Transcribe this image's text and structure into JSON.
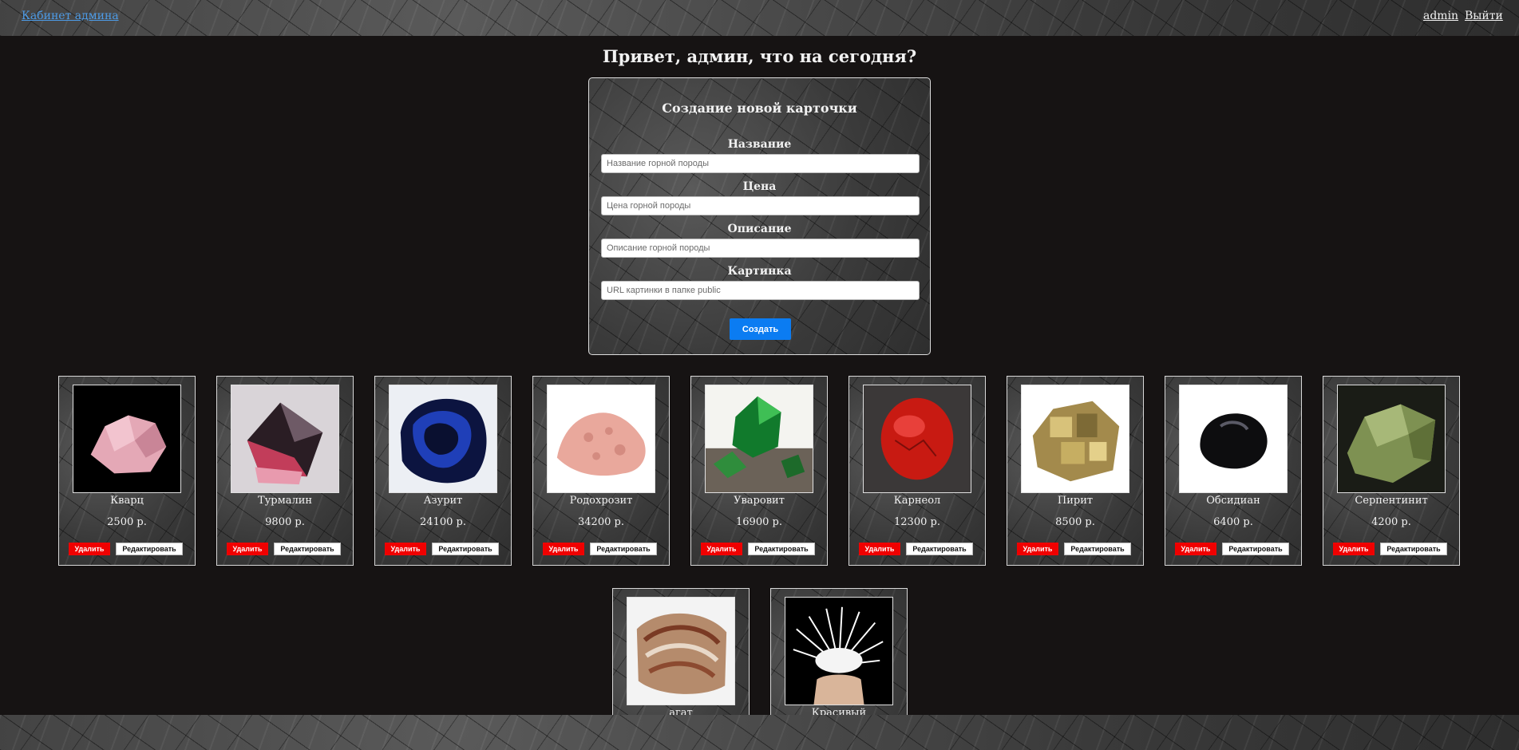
{
  "header": {
    "brand": "Кабинет админа",
    "user": "admin",
    "logout": "Выйти"
  },
  "greeting": "Привет, админ, что на сегодня?",
  "form": {
    "title": "Создание новой карточки",
    "fields": [
      {
        "label": "Название",
        "placeholder": "Название горной породы"
      },
      {
        "label": "Цена",
        "placeholder": "Цена горной породы"
      },
      {
        "label": "Описание",
        "placeholder": "Описание горной породы"
      },
      {
        "label": "Картинка",
        "placeholder": "URL картинки в папке public"
      }
    ],
    "submit": "Создать"
  },
  "card_actions": {
    "delete": "Удалить",
    "edit": "Редактировать"
  },
  "cards": [
    {
      "name": "Кварц",
      "price": "2500 р.",
      "image": "rose-quartz"
    },
    {
      "name": "Турмалин",
      "price": "9800 р.",
      "image": "tourmaline"
    },
    {
      "name": "Азурит",
      "price": "24100 р.",
      "image": "azurite"
    },
    {
      "name": "Родохрозит",
      "price": "34200 р.",
      "image": "rhodochrosite"
    },
    {
      "name": "Уваровит",
      "price": "16900 р.",
      "image": "uvarovite"
    },
    {
      "name": "Карнеол",
      "price": "12300 р.",
      "image": "carnelian"
    },
    {
      "name": "Пирит",
      "price": "8500 р.",
      "image": "pyrite"
    },
    {
      "name": "Обсидиан",
      "price": "6400 р.",
      "image": "obsidian"
    },
    {
      "name": "Серпентинит",
      "price": "4200 р.",
      "image": "serpentinite"
    },
    {
      "name": "агат",
      "price": "",
      "image": "agate"
    },
    {
      "name": "Красивый",
      "price": "",
      "image": "white-mineral"
    }
  ],
  "colors": {
    "background": "#161313",
    "link": "#4d9be6",
    "primary_button": "#0b7cf2",
    "delete_button": "#f00000"
  }
}
